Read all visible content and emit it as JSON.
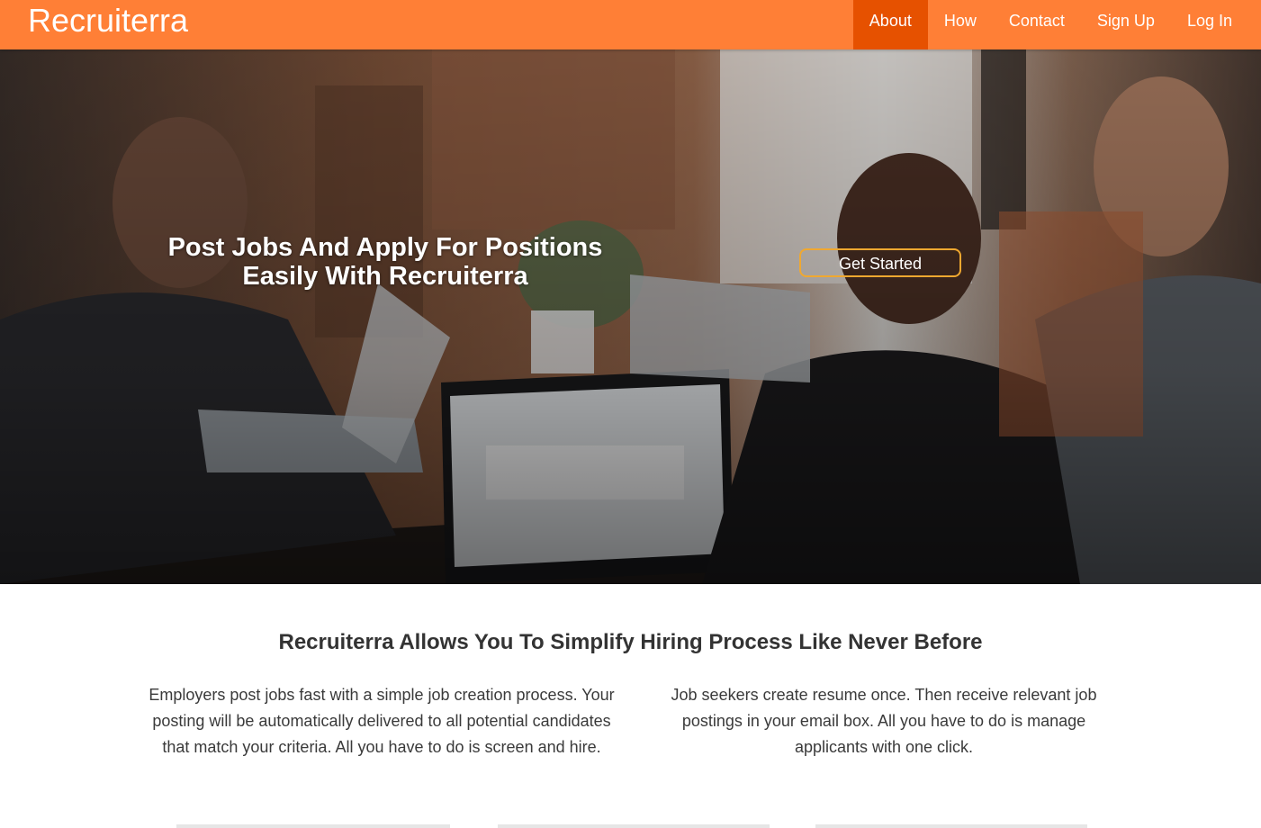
{
  "brand": "Recruiterra",
  "nav": {
    "items": [
      {
        "label": "About",
        "active": true
      },
      {
        "label": "How",
        "active": false
      },
      {
        "label": "Contact",
        "active": false
      },
      {
        "label": "Sign Up",
        "active": false
      },
      {
        "label": "Log In",
        "active": false
      }
    ]
  },
  "hero": {
    "title": "Post Jobs And Apply For Positions Easily With Recruiterra",
    "cta_label": "Get Started"
  },
  "intro": {
    "title": "Recruiterra Allows You To Simplify Hiring Process Like Never Before",
    "employers_text": "Employers post jobs fast with a simple job creation process. Your posting will be automatically delivered to all potential candidates that match your criteria. All you have to do is screen and hire.",
    "seekers_text": "Job seekers create resume once. Then receive relevant job postings in your email box. All you have to do is manage applicants with one click."
  },
  "colors": {
    "navbar": "#ff7f36",
    "nav_active": "#e65100",
    "cta_border": "#f0a830",
    "heading": "#333333"
  }
}
